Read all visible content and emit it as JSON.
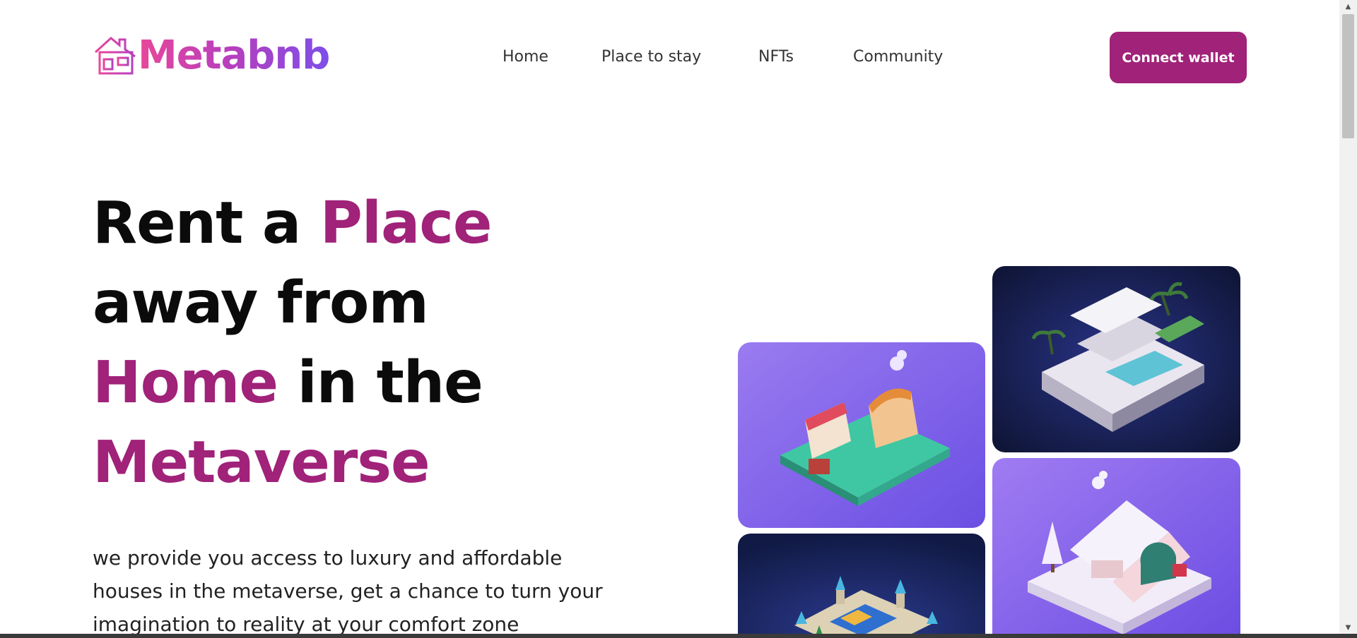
{
  "brand": {
    "name": "Metabnb",
    "icon": "house-icon"
  },
  "nav": {
    "items": [
      {
        "label": "Home"
      },
      {
        "label": "Place to stay"
      },
      {
        "label": "NFTs"
      },
      {
        "label": "Community"
      }
    ]
  },
  "header": {
    "cta_label": "Connect wallet"
  },
  "hero": {
    "title_parts": [
      "Rent a ",
      "Place",
      "away from",
      "Home",
      " in the",
      "Metaverse"
    ],
    "description": "we provide you access to luxury and affordable houses in the metaverse, get a chance to turn your imagination to reality at your comfort zone"
  },
  "gallery": [
    {
      "name": "market-stall-image"
    },
    {
      "name": "modern-villa-image"
    },
    {
      "name": "castle-image"
    },
    {
      "name": "winter-cottage-image"
    }
  ],
  "colors": {
    "accent": "#a02279",
    "logo_gradient_start": "#e8479a",
    "logo_gradient_end": "#7d4ee9"
  }
}
